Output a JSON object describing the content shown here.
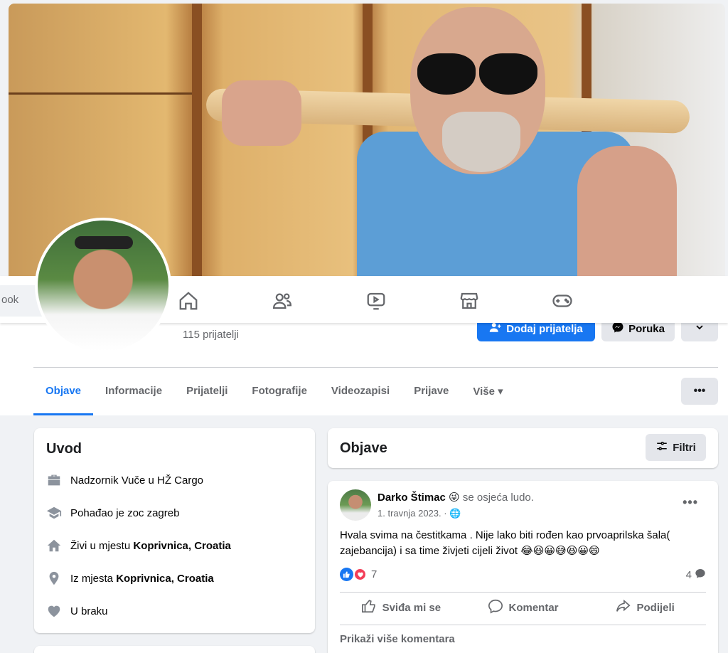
{
  "search": {
    "placeholder": "ook"
  },
  "nav_icons": [
    "home-icon",
    "friends-icon",
    "watch-icon",
    "marketplace-icon",
    "gaming-icon"
  ],
  "profile": {
    "friends_count": "115 prijatelji"
  },
  "actions": {
    "add_friend": "Dodaj prijatelja",
    "message": "Poruka",
    "dropdown": "⌄"
  },
  "tabs": [
    {
      "label": "Objave",
      "active": true
    },
    {
      "label": "Informacije"
    },
    {
      "label": "Prijatelji"
    },
    {
      "label": "Fotografije"
    },
    {
      "label": "Videozapisi"
    },
    {
      "label": "Prijave"
    },
    {
      "label": "Više ▾"
    }
  ],
  "tabs_more": "•••",
  "intro": {
    "title": "Uvod",
    "items": [
      {
        "icon": "briefcase-icon",
        "text": "Nadzornik Vuče u HŽ Cargo",
        "bold": ""
      },
      {
        "icon": "graduation-cap-icon",
        "text": "Pohađao je zoc zagreb",
        "bold": ""
      },
      {
        "icon": "house-icon",
        "text": "Živi u mjestu ",
        "bold": "Koprivnica, Croatia"
      },
      {
        "icon": "location-pin-icon",
        "text": "Iz mjesta ",
        "bold": "Koprivnica, Croatia"
      },
      {
        "icon": "heart-icon",
        "text": "U braku",
        "bold": ""
      }
    ]
  },
  "posts": {
    "title": "Objave",
    "filter_label": "Filtri"
  },
  "post": {
    "author": "Darko Štimac",
    "emoji": "😜",
    "feeling": "se osjeća ludo.",
    "date": "1. travnja 2023. · 🌐",
    "text": "Hvala svima na čestitkama . Nije lako biti rođen kao prvoaprilska šala( zajebancija) i sa time živjeti cijeli život 😂😆😀😅😆😀😄",
    "reactions_count": "7",
    "comments_count": "4",
    "like_label": "Sviđa mi se",
    "comment_label": "Komentar",
    "share_label": "Podijeli",
    "more_comments": "Prikaži više komentara",
    "menu": "•••"
  },
  "colors": {
    "accent": "#1877f2",
    "love": "#f33e58",
    "bg": "#f0f2f5"
  }
}
